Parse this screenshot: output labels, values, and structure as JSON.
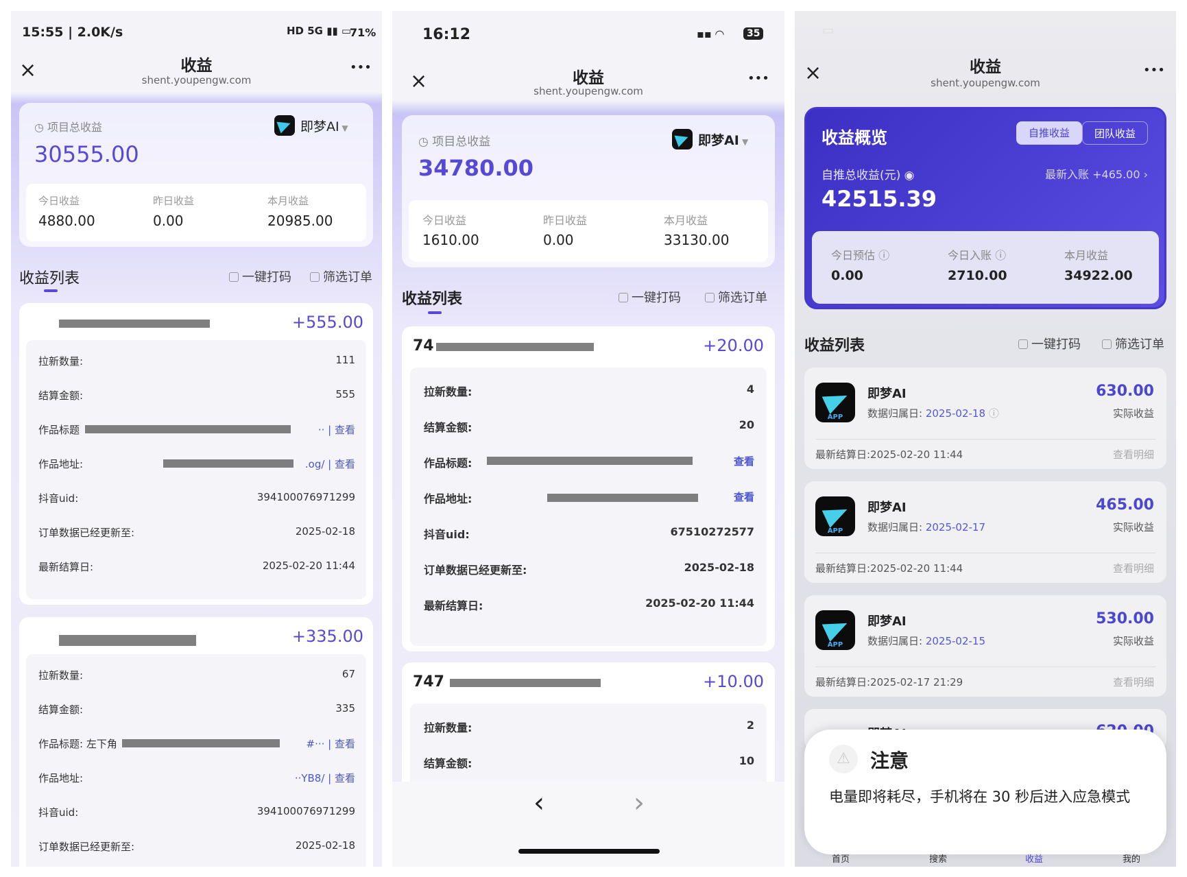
{
  "colors": {
    "accent": "#5649d6",
    "link": "#4a56d8",
    "overview_bg": "#4536d0"
  },
  "phone1": {
    "status": {
      "time": "15:55 | 2.0K/s",
      "battery": "71%"
    },
    "nav": {
      "close": "×",
      "title": "收益",
      "url": "shent.youpengw.com",
      "more": "•••"
    },
    "summary": {
      "label": "项目总收益",
      "total": "30555.00",
      "brand": "即梦AI",
      "stats": [
        {
          "label": "今日收益",
          "value": "4880.00"
        },
        {
          "label": "昨日收益",
          "value": "0.00"
        },
        {
          "label": "本月收益",
          "value": "20985.00"
        }
      ]
    },
    "list": {
      "title": "收益列表",
      "tool1": "一键打码",
      "tool2": "筛选订单"
    },
    "cards": [
      {
        "amount": "+555.00",
        "rows": [
          {
            "label": "拉新数量:",
            "value": "111"
          },
          {
            "label": "结算金额:",
            "value": "555"
          },
          {
            "label": "作品标题",
            "value": "·· | 查看"
          },
          {
            "label": "作品地址:",
            "value": ".og/ | 查看"
          },
          {
            "label": "抖音uid:",
            "value": "394100076971299"
          },
          {
            "label": "订单数据已经更新至:",
            "value": "2025-02-18"
          },
          {
            "label": "最新结算日:",
            "value": "2025-02-20 11:44"
          }
        ]
      },
      {
        "amount": "+335.00",
        "rows": [
          {
            "label": "拉新数量:",
            "value": "67"
          },
          {
            "label": "结算金额:",
            "value": "335"
          },
          {
            "label": "作品标题: 左下角",
            "value": "#··· | 查看"
          },
          {
            "label": "作品地址:",
            "value": "··YB8/ | 查看"
          },
          {
            "label": "抖音uid:",
            "value": "394100076971299"
          },
          {
            "label": "订单数据已经更新至:",
            "value": "2025-02-18"
          }
        ]
      }
    ]
  },
  "phone2": {
    "status": {
      "time": "16:12",
      "battery": "35"
    },
    "nav": {
      "close": "×",
      "title": "收益",
      "url": "shent.youpengw.com",
      "more": "•••"
    },
    "summary": {
      "label": "项目总收益",
      "total": "34780.00",
      "brand": "即梦AI",
      "stats": [
        {
          "label": "今日收益",
          "value": "1610.00"
        },
        {
          "label": "昨日收益",
          "value": "0.00"
        },
        {
          "label": "本月收益",
          "value": "33130.00"
        }
      ]
    },
    "list": {
      "title": "收益列表",
      "tool1": "一键打码",
      "tool2": "筛选订单"
    },
    "cards": [
      {
        "id": "74",
        "amount": "+20.00",
        "rows": [
          {
            "label": "拉新数量:",
            "value": "4"
          },
          {
            "label": "结算金额:",
            "value": "20"
          },
          {
            "label": "作品标题:",
            "value": "查看"
          },
          {
            "label": "作品地址:",
            "value": "查看"
          },
          {
            "label": "抖音uid:",
            "value": "67510272577"
          },
          {
            "label": "订单数据已经更新至:",
            "value": "2025-02-18"
          },
          {
            "label": "最新结算日:",
            "value": "2025-02-20 11:44"
          }
        ]
      },
      {
        "id": "747",
        "amount": "+10.00",
        "rows": [
          {
            "label": "拉新数量:",
            "value": "2"
          },
          {
            "label": "结算金额:",
            "value": "10"
          }
        ]
      }
    ],
    "bottom_nav": {
      "back": "‹",
      "forward": "›"
    }
  },
  "phone3": {
    "nav": {
      "close": "×",
      "title": "收益",
      "url": "shent.youpengw.com",
      "more": "•••"
    },
    "overview": {
      "title": "收益概览",
      "tab_active": "自推收益",
      "tab_inactive": "团队收益",
      "total_label": "自推总收益(元)",
      "latest": "最新入账 +465.00",
      "total": "42515.39",
      "stats": [
        {
          "label": "今日预估",
          "value": "0.00"
        },
        {
          "label": "今日入账",
          "value": "2710.00"
        },
        {
          "label": "本月收益",
          "value": "34922.00"
        }
      ]
    },
    "list": {
      "title": "收益列表",
      "tool1": "一键打码",
      "tool2": "筛选订单"
    },
    "items": [
      {
        "name": "即梦AI",
        "date_label": "数据归属日:",
        "date": "2025-02-18",
        "amount": "630.00",
        "sub": "实际收益",
        "settle": "最新结算日:2025-02-20 11:44",
        "detail": "查看明细",
        "tag": "APP"
      },
      {
        "name": "即梦AI",
        "date_label": "数据归属日:",
        "date": "2025-02-17",
        "amount": "465.00",
        "sub": "实际收益",
        "settle": "最新结算日:2025-02-20 11:44",
        "detail": "查看明细",
        "tag": "APP"
      },
      {
        "name": "即梦AI",
        "date_label": "数据归属日:",
        "date": "2025-02-15",
        "amount": "530.00",
        "sub": "实际收益",
        "settle": "最新结算日:2025-02-17 21:29",
        "detail": "查看明细",
        "tag": "APP"
      }
    ],
    "partial_item": {
      "name": "即梦AI",
      "amount": "620.00"
    },
    "alert": {
      "title": "注意",
      "message": "电量即将耗尽，手机将在 30 秒后进入应急模式"
    },
    "tabbar": [
      "首页",
      "搜索",
      "收益",
      "我的"
    ]
  }
}
